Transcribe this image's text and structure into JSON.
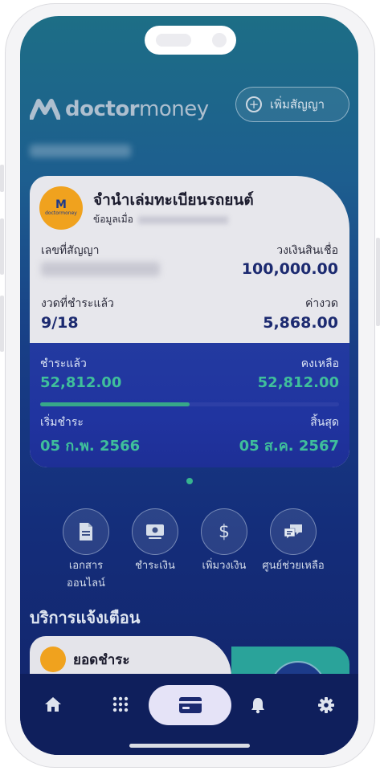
{
  "app": {
    "logo_text_bold": "doctor",
    "logo_text_light": "money",
    "add_contract_label": "เพิ่มสัญญา"
  },
  "loan_card": {
    "brand_mini": "doctormoney",
    "title": "จำนำเล่มทะเบียนรถยนต์",
    "subtitle_prefix": "ข้อมูลเมื่อ",
    "contract_no_label": "เลขที่สัญญา",
    "credit_limit_label": "วงเงินสินเชื่อ",
    "credit_limit_value": "100,000.00",
    "installments_paid_label": "งวดที่ชำระแล้ว",
    "installments_paid_value": "9/18",
    "installment_amount_label": "ค่างวด",
    "installment_amount_value": "5,868.00",
    "paid_label": "ชำระแล้ว",
    "paid_value": "52,812.00",
    "remaining_label": "คงเหลือ",
    "remaining_value": "52,812.00",
    "progress_fraction": 0.5,
    "start_label": "เริ่มชำระ",
    "start_value": "05 ก.พ. 2566",
    "end_label": "สิ้นสุด",
    "end_value": "05 ส.ค. 2567"
  },
  "quick_actions": [
    {
      "label_line1": "เอกสาร",
      "label_line2": "ออนไลน์",
      "icon": "document-icon"
    },
    {
      "label_line1": "ชำระเงิน",
      "label_line2": "",
      "icon": "payment-icon"
    },
    {
      "label_line1": "เพิ่มวงเงิน",
      "label_line2": "",
      "icon": "dollar-icon"
    },
    {
      "label_line1": "ศูนย์ช่วยเหลือ",
      "label_line2": "",
      "icon": "chat-icon"
    }
  ],
  "notifications": {
    "section_title": "บริการแจ้งเตือน",
    "card_title": "ยอดชำระ"
  },
  "tabbar": {
    "items": [
      "home-icon",
      "apps-grid-icon",
      "card-icon",
      "bell-icon",
      "gear-icon"
    ],
    "active": "card-icon"
  },
  "colors": {
    "accent_green": "#3fbf9b",
    "brand_orange": "#f0a21e",
    "navy": "#1c2a70",
    "tabbar": "#0f1f5c"
  }
}
